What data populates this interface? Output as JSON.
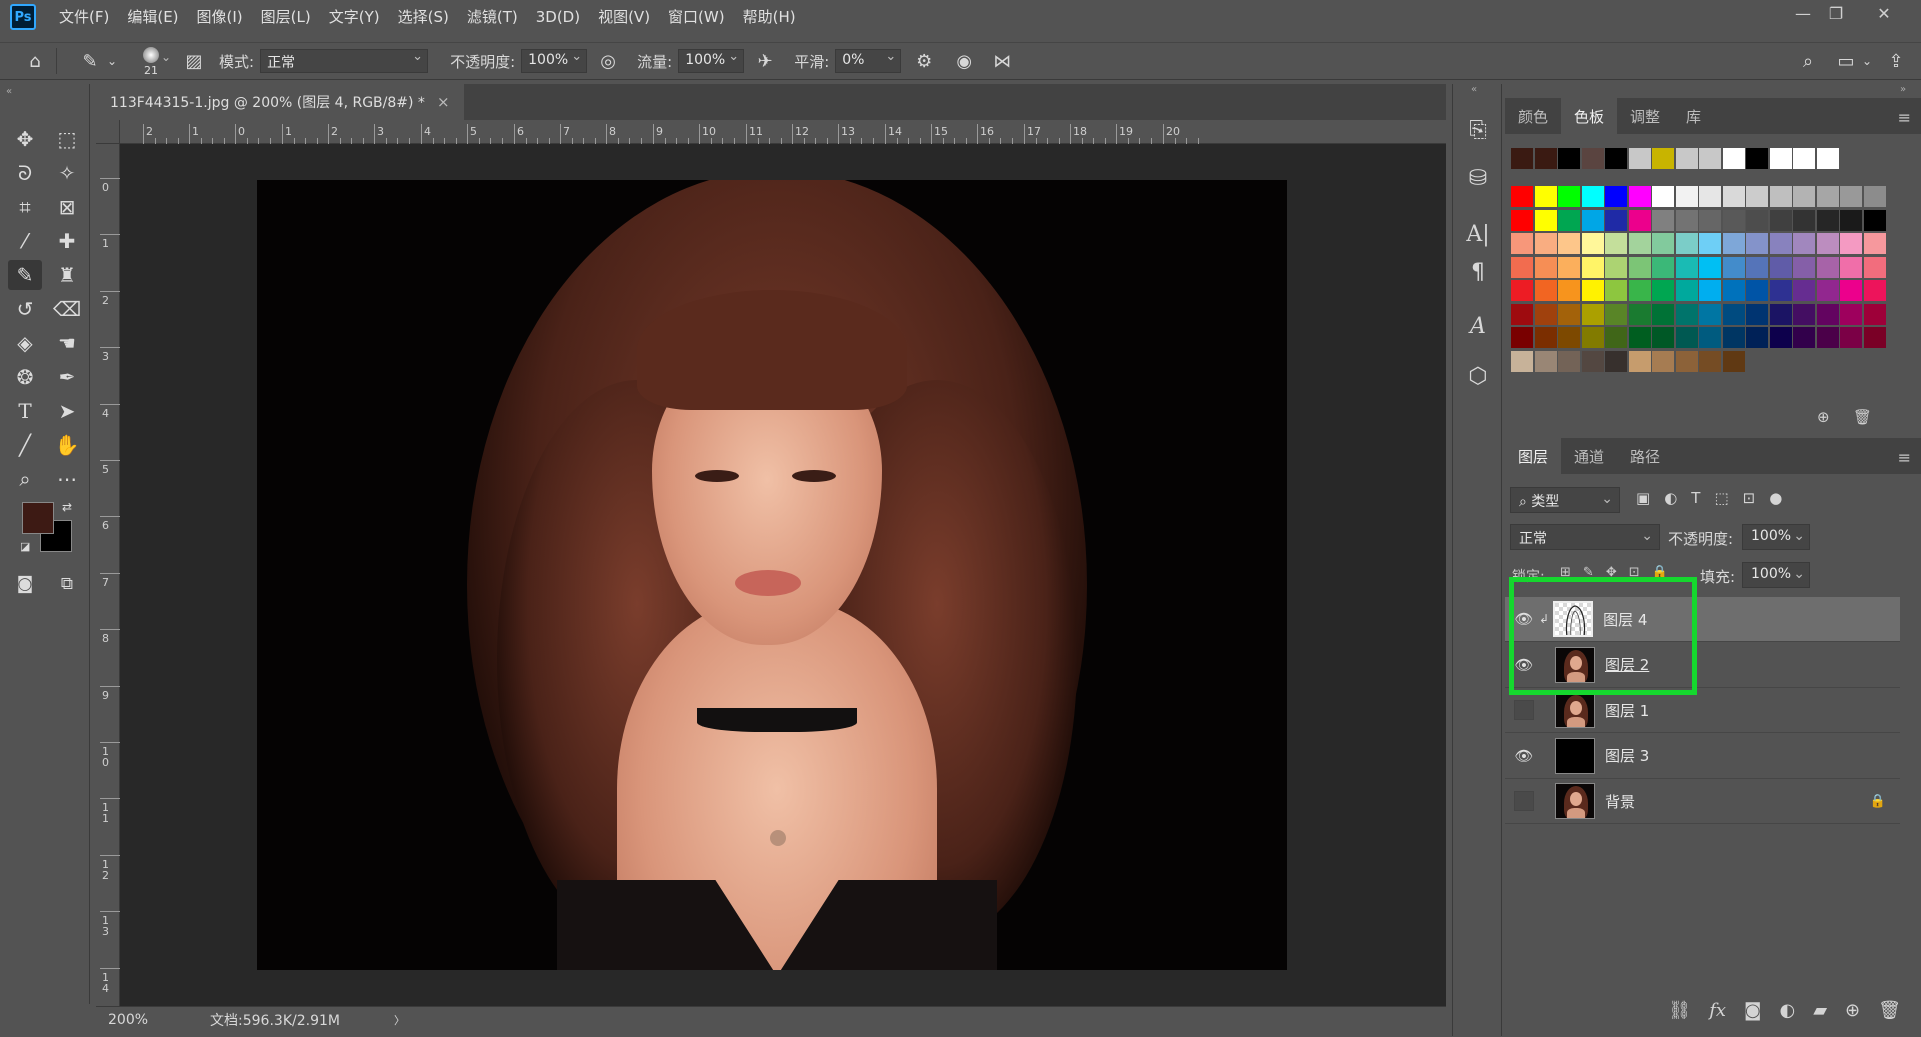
{
  "app": {
    "logo": "Ps"
  },
  "menu": [
    "文件(F)",
    "编辑(E)",
    "图像(I)",
    "图层(L)",
    "文字(Y)",
    "选择(S)",
    "滤镜(T)",
    "3D(D)",
    "视图(V)",
    "窗口(W)",
    "帮助(H)"
  ],
  "window_controls": {
    "minimize": "—",
    "restore": "❐",
    "close": "✕"
  },
  "options": {
    "brush_size": "21",
    "mode_label": "模式:",
    "mode_value": "正常",
    "opacity_label": "不透明度:",
    "opacity_value": "100%",
    "flow_label": "流量:",
    "flow_value": "100%",
    "smoothing_label": "平滑:",
    "smoothing_value": "0%"
  },
  "document": {
    "tab_title": "113F44315-1.jpg @ 200% (图层 4, RGB/8#) *",
    "close": "×"
  },
  "ruler": {
    "top_labels": [
      "2",
      "1",
      "0",
      "1",
      "2",
      "3",
      "4",
      "5",
      "6",
      "7",
      "8",
      "9",
      "10",
      "11",
      "12",
      "13",
      "14",
      "15",
      "16",
      "17",
      "18",
      "19",
      "20"
    ],
    "left_labels": [
      "0",
      "1",
      "2",
      "3",
      "4",
      "5",
      "6",
      "7",
      "8",
      "9",
      "1\n0",
      "1\n1",
      "1\n2",
      "1\n3",
      "1\n4"
    ]
  },
  "status": {
    "zoom": "200%",
    "doc_info": "文档:596.3K/2.91M",
    "arrow": "〉"
  },
  "swatches_panel": {
    "tabs": [
      "颜色",
      "色板",
      "调整",
      "库"
    ],
    "active_tab": "色板",
    "recent": [
      "#3a1a12",
      "#3a1a12",
      "#000000",
      "#5a4440",
      "#000000",
      "#c8c8c8",
      "#c8b400",
      "#c8c8c8",
      "#c8c8c8",
      "#ffffff",
      "#000000",
      "#ffffff",
      "#ffffff",
      "#ffffff"
    ],
    "grid": [
      [
        "#ff0000",
        "#ffff00",
        "#00ff00",
        "#00ffff",
        "#0000ff",
        "#ff00ff",
        "#ffffff",
        "#f2f2f2",
        "#e6e6e6",
        "#d9d9d9",
        "#cccccc",
        "#bfbfbf",
        "#b3b3b3",
        "#a6a6a6",
        "#999999",
        "#8c8c8c"
      ],
      [
        "#ff0000",
        "#ffff00",
        "#00a651",
        "#00a6e6",
        "#1f2aa6",
        "#ec008c",
        "#808080",
        "#737373",
        "#666666",
        "#595959",
        "#4d4d4d",
        "#404040",
        "#333333",
        "#262626",
        "#1a1a1a",
        "#000000"
      ],
      [
        "#f7977a",
        "#f9ad81",
        "#fdc68a",
        "#fff79a",
        "#c4df9b",
        "#a3d39c",
        "#82ca9d",
        "#7bcdc8",
        "#6ecff6",
        "#7ea7d8",
        "#8493ca",
        "#8882be",
        "#a187be",
        "#bc8dbf",
        "#f49ac2",
        "#f6989d"
      ],
      [
        "#f26c4f",
        "#f68e55",
        "#fbaf5c",
        "#fff467",
        "#acd372",
        "#7cc576",
        "#3bb878",
        "#1abbb4",
        "#00bff3",
        "#438ccb",
        "#5574b9",
        "#605ca8",
        "#855fa8",
        "#a763a8",
        "#f06ea9",
        "#f26d7d"
      ],
      [
        "#ed1c24",
        "#f26522",
        "#f7941d",
        "#fff200",
        "#8dc63f",
        "#39b54a",
        "#00a651",
        "#00a99d",
        "#00aeef",
        "#0072bc",
        "#0054a6",
        "#2e3192",
        "#662d91",
        "#92278f",
        "#ec008c",
        "#ed145b"
      ],
      [
        "#9e0b0f",
        "#a0410d",
        "#a3620a",
        "#aba000",
        "#598527",
        "#1a7b30",
        "#007236",
        "#00746b",
        "#0076a3",
        "#004b80",
        "#003471",
        "#1b1464",
        "#440e62",
        "#630460",
        "#9e005d",
        "#9e0039"
      ],
      [
        "#790000",
        "#7b2e00",
        "#7d4900",
        "#827b00",
        "#406618",
        "#005e20",
        "#005826",
        "#005952",
        "#005b7f",
        "#003663",
        "#002157",
        "#0d004c",
        "#32004b",
        "#4b0049",
        "#7b0046",
        "#7a0026"
      ],
      [
        "#c7b299",
        "#998675",
        "#736357",
        "#534741",
        "#37302d",
        "#c69c6d",
        "#a67c52",
        "#8c6239",
        "#754c24",
        "#603913"
      ]
    ]
  },
  "layers_panel": {
    "tabs": [
      "图层",
      "通道",
      "路径"
    ],
    "active_tab": "图层",
    "filter_label": "类型",
    "blend_mode": "正常",
    "opacity_label": "不透明度:",
    "opacity_value": "100%",
    "lock_label": "锁定:",
    "fill_label": "填充:",
    "fill_value": "100%",
    "layers": [
      {
        "name": "图层 4",
        "visible": true,
        "selected": true,
        "clipped": true,
        "thumb": "transparent-sketch"
      },
      {
        "name": "图层 2",
        "visible": true,
        "selected": false,
        "clipped": false,
        "thumb": "photo"
      },
      {
        "name": "图层 1",
        "visible": false,
        "selected": false,
        "clipped": false,
        "thumb": "photo"
      },
      {
        "name": "图层 3",
        "visible": true,
        "selected": false,
        "clipped": false,
        "thumb": "black"
      },
      {
        "name": "背景",
        "visible": false,
        "selected": false,
        "clipped": false,
        "thumb": "photo",
        "locked": true
      }
    ]
  },
  "colors": {
    "foreground": "#3d1a14",
    "background": "#000000",
    "highlight": "#15d72e"
  }
}
